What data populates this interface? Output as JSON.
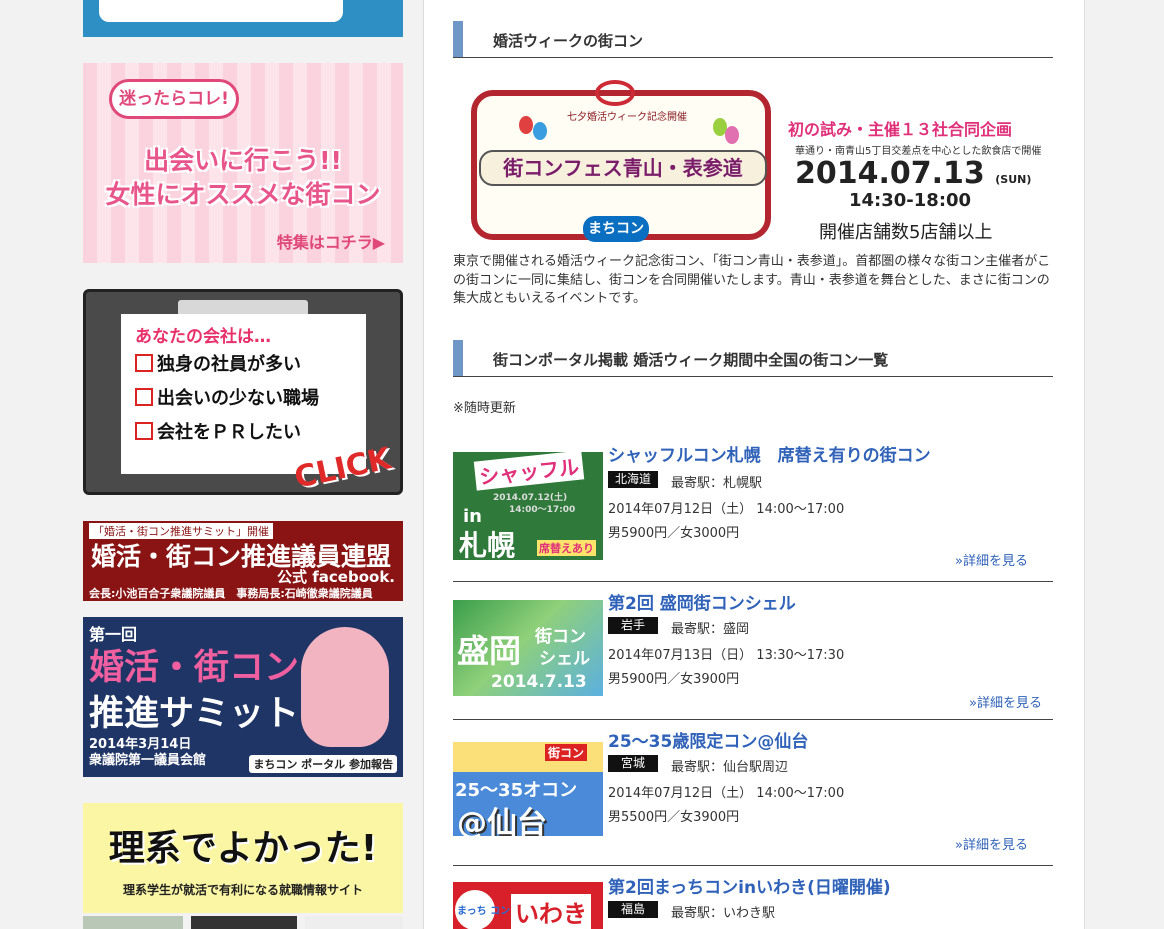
{
  "sidebar": {
    "banner_pink": {
      "bubble": "迷ったらコレ!",
      "line1": "出会いに行こう!!",
      "line2": "女性にオススメな街コン",
      "more": "特集はコチラ▶"
    },
    "banner_click": {
      "question": "あなたの会社は…",
      "items": [
        "独身の社員が多い",
        "出会いの少ない職場",
        "会社をＰＲしたい"
      ],
      "click": "CLICK"
    },
    "banner_federation": {
      "tag": "「婚活・街コン推進サミット」開催",
      "title": "婚活・街コン推進議員連盟",
      "sub": "公式 facebook.",
      "members": "会長:小池百合子衆議院議員　事務局長:石崎徹衆議院議員"
    },
    "banner_summit": {
      "line1": "第一回",
      "line2": "婚活・街コン",
      "line3": "推進サミット",
      "date": "2014年3月14日",
      "venue": "衆議院第一議員会館",
      "brand": "まちコン ポータル 参加報告"
    },
    "banner_rikei": {
      "title": "理系でよかった!",
      "sub": "理系学生が就活で有利になる就職情報サイト"
    }
  },
  "main": {
    "section1_title": "婚活ウィークの街コン",
    "hero": {
      "frame_top": "七夕婚活ウィーク記念開催",
      "fest_name": "街コンフェス青山・表参道",
      "logo": "まちコン",
      "headline": "初の試み・主催１３社合同企画",
      "area": "華通り・南青山5丁目交差点を中心とした飲食店で開催",
      "date": "2014.07.13",
      "weekday": "(SUN)",
      "time": "14:30-18:00",
      "stores": "開催店舗数5店舗以上"
    },
    "description": "東京で開催される婚活ウィーク記念街コン、「街コン青山・表参道」。首都圏の様々な街コン主催者がこの街コンに一同に集結し、街コンを合同開催いたします。青山・表参道を舞台とした、まさに街コンの集大成ともいえるイベントです。",
    "section2_title": "街コンポータル掲載 婚活ウィーク期間中全国の街コン一覧",
    "update_note": "※随時更新",
    "events": [
      {
        "title": "シャッフルコン札幌　席替え有りの街コン",
        "prefecture": "北海道",
        "station": "最寄駅：札幌駅",
        "datetime": "2014年07月12日（土） 14:00～17:00",
        "price": "男5900円／女3000円",
        "more": "»詳細を見る",
        "thumb_lines": [
          "シャッフル",
          "2014.07.12(土)",
          "14:00～17:00",
          "in",
          "札幌",
          "席替えあり"
        ]
      },
      {
        "title": "第2回 盛岡街コンシェル",
        "prefecture": "岩手",
        "station": "最寄駅：盛岡",
        "datetime": "2014年07月13日（日） 13:30～17:30",
        "price": "男5900円／女3900円",
        "more": "»詳細を見る",
        "thumb_lines": [
          "盛岡",
          "街コン",
          "シェル",
          "2014.7.13"
        ]
      },
      {
        "title": "25～35歳限定コン@仙台",
        "prefecture": "宮城",
        "station": "最寄駅：仙台駅周辺",
        "datetime": "2014年07月12日（土） 14:00～17:00",
        "price": "男5500円／女3900円",
        "more": "»詳細を見る",
        "thumb_lines": [
          "街コン",
          "25～35オコン",
          "@仙台"
        ]
      },
      {
        "title": "第2回まっちコンinいわき(日曜開催)",
        "prefecture": "福島",
        "station": "最寄駅：いわき駅",
        "thumb_lines": [
          "まっち コン",
          "いわき"
        ]
      }
    ]
  },
  "colors": {
    "link": "#2f62b8",
    "section_bar": "#6e97c8",
    "tag_bg": "#111111",
    "page_bg": "#f2f2f2"
  }
}
